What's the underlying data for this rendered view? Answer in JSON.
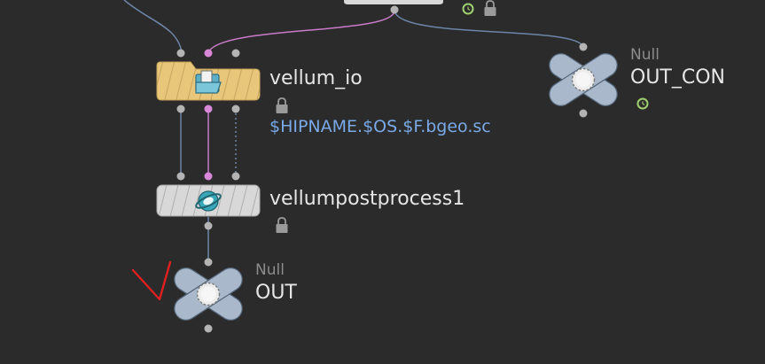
{
  "network": {
    "nodes": [
      {
        "id": "vellum_io",
        "name": "vellum_io",
        "icon": "folder-file-icon",
        "locked": true,
        "param_value": "$HIPNAME.$OS.$F.bgeo.sc"
      },
      {
        "id": "vellumpostprocess1",
        "name": "vellumpostprocess1",
        "icon": "vellum-postprocess-icon",
        "locked": true
      },
      {
        "id": "OUT_CON",
        "type": "Null",
        "name": "OUT_CON",
        "icon": "null-sop-icon",
        "time_dependent": true
      },
      {
        "id": "OUT",
        "type": "Null",
        "name": "OUT",
        "icon": "null-sop-icon",
        "display_flag": true
      }
    ],
    "upstream": {
      "locked": true,
      "time_dependent": true
    }
  },
  "colors": {
    "background": "#2b2b2b",
    "wire_geometry": "#6d85a8",
    "wire_constraint": "#c97ac9",
    "node_body": "#d8d8d8",
    "node_io": "#e8c77a",
    "null_body": "#a9b9cb",
    "port": "#b4b4b4",
    "port_pink": "#d987d9",
    "name_text": "#e6e6e6",
    "type_text": "#8c8c8c",
    "param_text": "#79a9e6",
    "display_flag": "#e02020",
    "clock_icon": "#9fcf6f"
  }
}
